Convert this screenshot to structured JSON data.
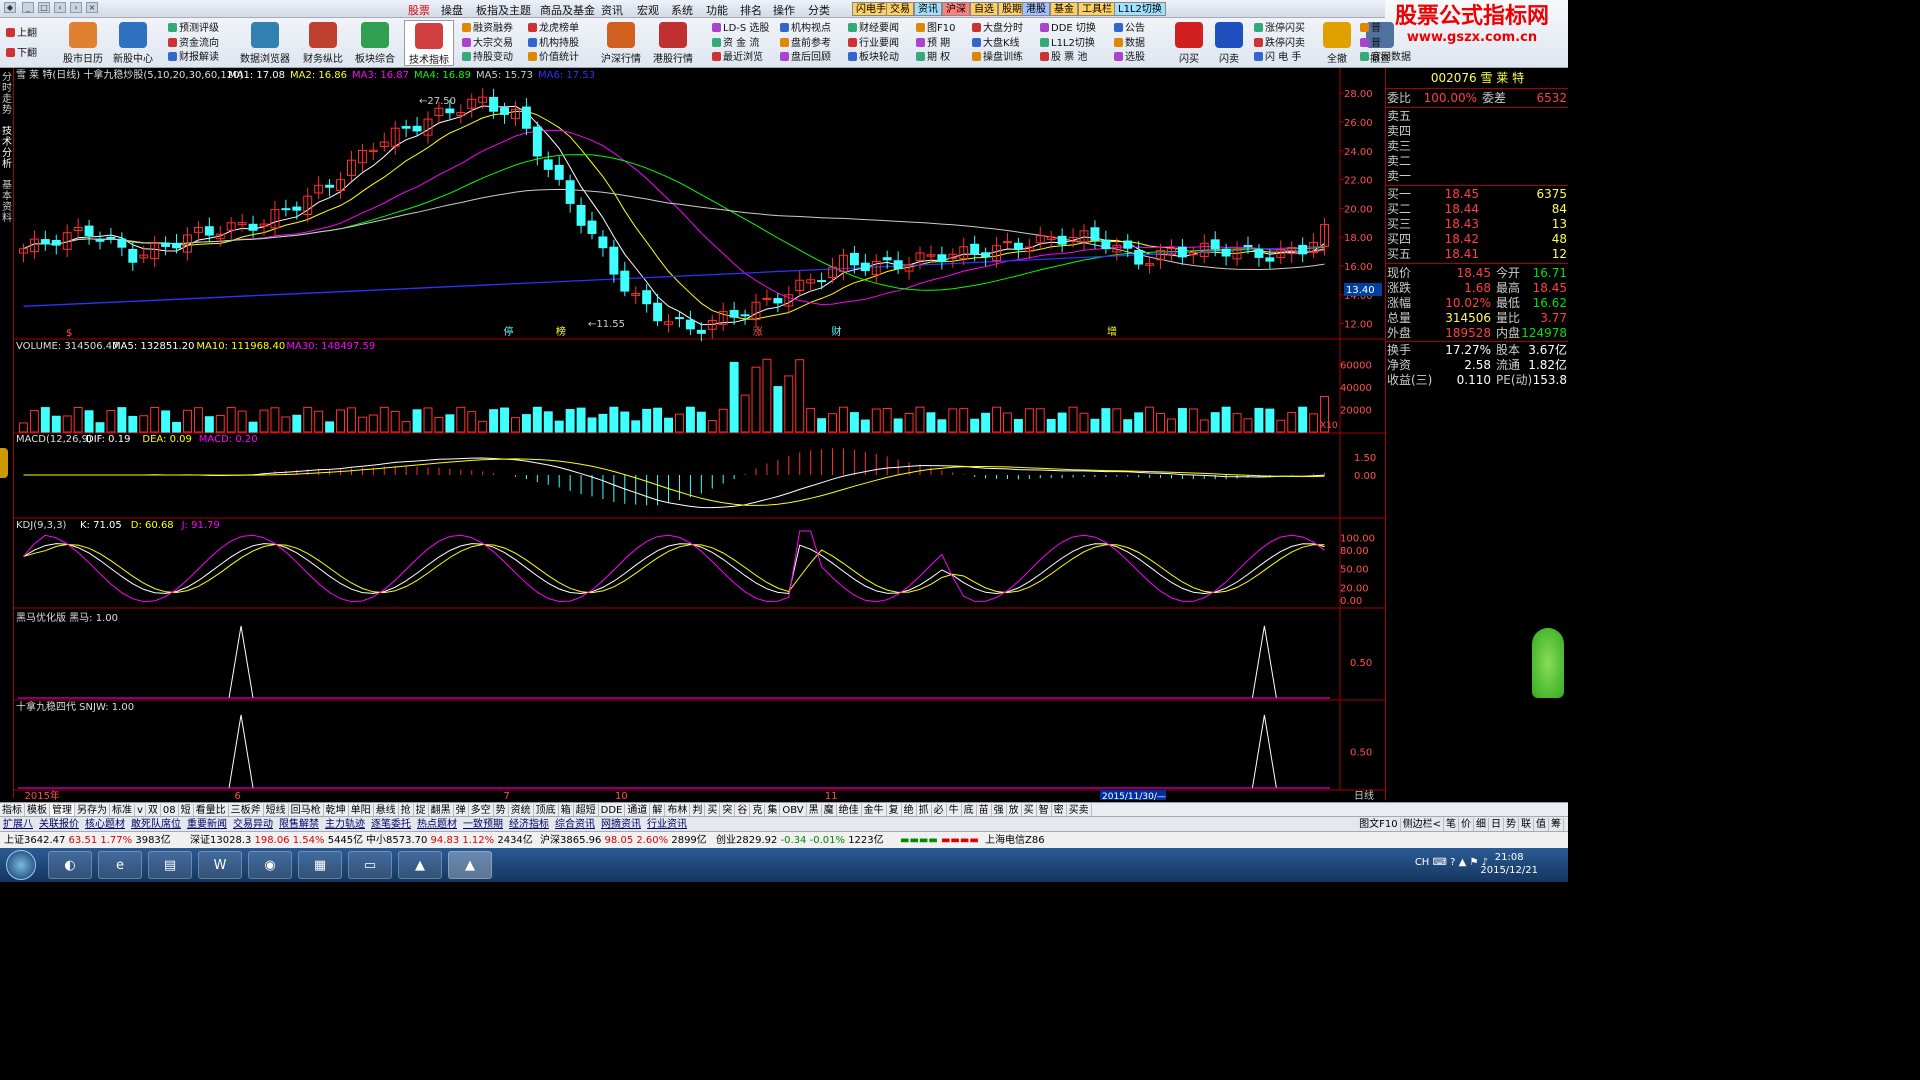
{
  "menubar": {
    "items": [
      "股票",
      "操盘",
      "板指及主题",
      "商品及基金",
      "资讯",
      "宏观",
      "系统",
      "功能",
      "排名",
      "操作",
      "分类"
    ],
    "tags": [
      {
        "label": "闪电手",
        "color": "#ffd060"
      },
      {
        "label": "交易",
        "color": "#ffd060"
      },
      {
        "label": "资讯",
        "color": "#a0e0ff"
      },
      {
        "label": "沪深",
        "color": "#ff8080"
      },
      {
        "label": "自选",
        "color": "#ffd060"
      },
      {
        "label": "股期",
        "color": "#ffd060"
      },
      {
        "label": "港股",
        "color": "#a0c0ff"
      },
      {
        "label": "基金",
        "color": "#ffd060"
      },
      {
        "label": "工具栏",
        "color": "#ffd060"
      },
      {
        "label": "L1L2切换",
        "color": "#a0e0ff"
      }
    ]
  },
  "toolbar": {
    "pager": [
      "上翻",
      "下翻"
    ],
    "big": [
      {
        "label": "股市日历",
        "color": "#e08030"
      },
      {
        "label": "新股中心",
        "color": "#3070c0"
      },
      {
        "label": "数据浏览器",
        "color": "#3080b0"
      },
      {
        "label": "财务纵比",
        "color": "#c04030"
      },
      {
        "label": "板块综合",
        "color": "#30a050"
      },
      {
        "label": "技术指标",
        "color": "#d04040"
      },
      {
        "label": "沪深行情",
        "color": "#d06020"
      },
      {
        "label": "港股行情",
        "color": "#c03030"
      },
      {
        "label": "闪买",
        "color": "#d02020"
      },
      {
        "label": "闪卖",
        "color": "#2050c0"
      },
      {
        "label": "全撤",
        "color": "#e0a000"
      },
      {
        "label": "撤查",
        "color": "#5070a0"
      }
    ],
    "small": [
      "预测评级",
      "资金流向",
      "财报解读",
      "融资融券",
      "大宗交易",
      "持股变动",
      "龙虎榜单",
      "机构持股",
      "价值统计",
      "LD-S 选股",
      "资 金 流",
      "最近浏览",
      "机构视点",
      "盘前参考",
      "盘后回顾",
      "财经要闻",
      "行业要闻",
      "板块轮动",
      "图F10",
      "预 期",
      "期 权",
      "大盘分时",
      "大盘K线",
      "操盘训练",
      "DDE 切换",
      "L1L2切换",
      "股 票 池",
      "公告",
      "数据",
      "选股",
      "涨停闪买",
      "跌停闪卖",
      "闪 电 手",
      "普",
      "普",
      "官网数据"
    ]
  },
  "logo": {
    "line1": "股票公式指标网",
    "line2": "www.gszx.com.cn"
  },
  "side_tabs": [
    "分时走势",
    "技术分析",
    "基本资料"
  ],
  "chart_data": {
    "type": "candlestick",
    "title": "雪 莱 特(日线) 十拿九稳炒股(5,10,20,30,60,120)",
    "ma_legend": [
      {
        "label": "MA1: 17.08",
        "color": "#ffffff"
      },
      {
        "label": "MA2: 16.86",
        "color": "#ffff00"
      },
      {
        "label": "MA3: 16.87",
        "color": "#ff00ff"
      },
      {
        "label": "MA4: 16.89",
        "color": "#00ff00"
      },
      {
        "label": "MA5: 15.73",
        "color": "#cccccc"
      },
      {
        "label": "MA6: 17.53",
        "color": "#3030ff"
      }
    ],
    "y_ticks": [
      "28.00",
      "26.00",
      "24.00",
      "22.00",
      "20.00",
      "18.00",
      "16.00",
      "14.00",
      "12.00"
    ],
    "ylim": [
      11,
      28.5
    ],
    "annotations": {
      "high": "27.50",
      "low": "11.55",
      "price_marker": "13.40",
      "events": [
        "停",
        "榜",
        "涨",
        "财",
        "增"
      ]
    },
    "volume": {
      "title": "VOLUME: 314506.47",
      "ma": [
        {
          "label": "MA5: 132851.20",
          "color": "#ffffff"
        },
        {
          "label": "MA10: 111968.40",
          "color": "#ffff00"
        },
        {
          "label": "MA30: 148497.59",
          "color": "#ff00ff"
        }
      ],
      "y_ticks": [
        "60000",
        "40000",
        "20000"
      ],
      "unit": "X10",
      "ylim": [
        0,
        70000
      ]
    },
    "macd": {
      "title": "MACD(12,26,9)",
      "ma": [
        {
          "label": "DIF: 0.19",
          "color": "#ffffff"
        },
        {
          "label": "DEA: 0.09",
          "color": "#ffff00"
        },
        {
          "label": "MACD: 0.20",
          "color": "#ff00ff"
        }
      ],
      "y_ticks": [
        "1.50",
        "0.00"
      ],
      "ylim": [
        -3.5,
        2.5
      ]
    },
    "kdj": {
      "title": "KDJ(9,3,3)",
      "ma": [
        {
          "label": "K: 71.05",
          "color": "#ffffff"
        },
        {
          "label": "D: 60.68",
          "color": "#ffff00"
        },
        {
          "label": "J: 91.79",
          "color": "#ff00ff"
        }
      ],
      "y_ticks": [
        "100.00",
        "80.00",
        "50.00",
        "20.00",
        "0.00"
      ],
      "ylim": [
        -10,
        110
      ]
    },
    "heima": {
      "title": "黑马优化版 黑马: 1.00",
      "y_tick": "0.50",
      "spike_positions": [
        0.17,
        0.95
      ]
    },
    "snjw": {
      "title": "十拿九稳四代 SNJW: 1.00",
      "y_tick": "0.50",
      "spike_positions": [
        0.17,
        0.95
      ]
    },
    "x_labels": [
      {
        "label": "2015年",
        "pos": 0.005
      },
      {
        "label": "6",
        "pos": 0.165
      },
      {
        "label": "7",
        "pos": 0.37
      },
      {
        "label": "10",
        "pos": 0.455
      },
      {
        "label": "11",
        "pos": 0.615
      }
    ],
    "x_highlight": "2015/11/30/—",
    "x_right": "日线"
  },
  "quote": {
    "code_name": "002076 雪 莱 特",
    "weibi": {
      "label": "委比",
      "value": "100.00%",
      "label2": "委差",
      "value2": "6532"
    },
    "asks": [
      "卖五",
      "卖四",
      "卖三",
      "卖二",
      "卖一"
    ],
    "bids": [
      {
        "label": "买一",
        "price": "18.45",
        "vol": "6375"
      },
      {
        "label": "买二",
        "price": "18.44",
        "vol": "84"
      },
      {
        "label": "买三",
        "price": "18.43",
        "vol": "13"
      },
      {
        "label": "买四",
        "price": "18.42",
        "vol": "48"
      },
      {
        "label": "买五",
        "price": "18.41",
        "vol": "12"
      }
    ],
    "stats": [
      {
        "l1": "现价",
        "v1": "18.45",
        "c1": "red",
        "l2": "今开",
        "v2": "16.71",
        "c2": "green"
      },
      {
        "l1": "涨跌",
        "v1": "1.68",
        "c1": "red",
        "l2": "最高",
        "v2": "18.45",
        "c2": "red"
      },
      {
        "l1": "涨幅",
        "v1": "10.02%",
        "c1": "red",
        "l2": "最低",
        "v2": "16.62",
        "c2": "green"
      },
      {
        "l1": "总量",
        "v1": "314506",
        "c1": "yel",
        "l2": "量比",
        "v2": "3.77",
        "c2": "red"
      },
      {
        "l1": "外盘",
        "v1": "189528",
        "c1": "red",
        "l2": "内盘",
        "v2": "124978",
        "c2": "green"
      },
      {
        "l1": "换手",
        "v1": "17.27%",
        "c1": "wht",
        "l2": "股本",
        "v2": "3.67亿",
        "c2": "wht"
      },
      {
        "l1": "净资",
        "v1": "2.58",
        "c1": "wht",
        "l2": "流通",
        "v2": "1.82亿",
        "c2": "wht"
      },
      {
        "l1": "收益(三)",
        "v1": "0.110",
        "c1": "wht",
        "l2": "PE(动)",
        "v2": "153.8",
        "c2": "wht"
      }
    ]
  },
  "bottom_tabs": [
    "指标",
    "模板",
    "管理",
    "另存为",
    "标准",
    "v",
    "双",
    "08",
    "短",
    "看量比",
    "三板斧",
    "短线",
    "回马枪",
    "乾坤",
    "单阳",
    "悬线",
    "抢",
    "捉",
    "翻黑",
    "弹",
    "多空",
    "势",
    "资统",
    "顶底",
    "箱",
    "超短",
    "DDE",
    "通道",
    "解",
    "布林",
    "判",
    "买",
    "突",
    "谷",
    "克",
    "集",
    "OBV",
    "黑",
    "魔",
    "绝佳",
    "金牛",
    "复",
    "绝",
    "抓",
    "必",
    "牛",
    "底",
    "苗",
    "强",
    "放",
    "买",
    "智",
    "密",
    "买卖"
  ],
  "bottom_tabs2": [
    "扩展八",
    "关联报价",
    "核心题材",
    "敢死队席位",
    "重要新闻",
    "交易异动",
    "限售解禁",
    "主力轨迹",
    "逐笔委托",
    "热点题材",
    "一致预期",
    "经济指标",
    "综合资讯",
    "网摘资讯",
    "行业资讯"
  ],
  "bottom_right": [
    "图文F10",
    "侧边栏<",
    "笔",
    "价",
    "细",
    "日",
    "势",
    "联",
    "值",
    "筹"
  ],
  "status": {
    "sh": "上证3642.47",
    "sh_chg": "63.51",
    "sh_pct": "1.77%",
    "sh_amt": "3983亿",
    "sz": "深证13028.3",
    "sz_chg": "198.06",
    "sz_pct": "1.54%",
    "sz_amt": "5445亿",
    "zx": "中小8573.70",
    "zx_chg": "94.83",
    "zx_pct": "1.12%",
    "zx_amt": "2434亿",
    "hs": "沪深3865.96",
    "hs_chg": "98.05",
    "hs_pct": "2.60%",
    "hs_amt": "2899亿",
    "cy": "创业2829.92",
    "cy_chg": "-0.34",
    "cy_pct": "-0.01%",
    "cy_amt": "1223亿",
    "server": "上海电信Z86"
  },
  "taskbar": {
    "time": "21:08",
    "date": "2015/12/21",
    "tray": "CH"
  }
}
